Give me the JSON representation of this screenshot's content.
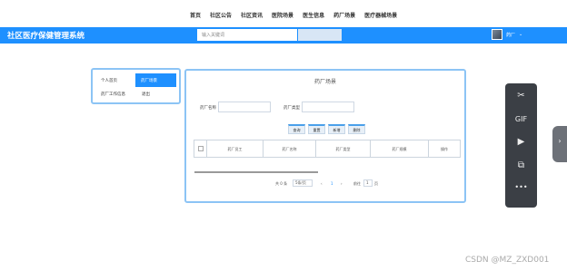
{
  "topnav": {
    "links": [
      "首页",
      "社区公告",
      "社区资讯",
      "医院场景",
      "医生信息",
      "药厂场景",
      "医疗器械场景"
    ]
  },
  "header": {
    "brand": "社区医疗保健管理系统",
    "search_placeholder": "输入关键词",
    "user_name": "药厂",
    "caret": "⌄"
  },
  "sidebar": {
    "items": [
      "个人首页",
      "药厂场景",
      "药厂工作信息",
      "退出"
    ]
  },
  "main": {
    "title": "药厂场景",
    "form": {
      "label_name": "药厂名称",
      "label_type": "药厂类型"
    },
    "buttons": [
      "查询",
      "重置",
      "新增",
      "删除"
    ],
    "table_headers": [
      "药厂员工",
      "药厂名称",
      "药厂类型",
      "药厂规模",
      "操作"
    ],
    "pagination": {
      "total": "共 0 条",
      "page_size": "5条/页",
      "prev": "‹",
      "page": "1",
      "next": "›",
      "goto_label": "前往",
      "goto_value": "1",
      "page_suffix": "页"
    }
  },
  "floatbar": {
    "gif": "GIF",
    "more": "•••"
  },
  "sidetab": {
    "arrow": "›"
  },
  "watermark": "CSDN @MZ_ZXD001"
}
